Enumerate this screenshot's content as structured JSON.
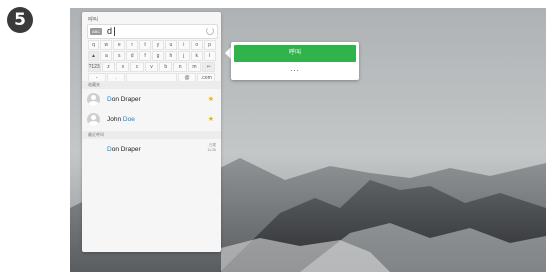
{
  "step": {
    "number": "5"
  },
  "panel": {
    "title": "呼叫",
    "search": {
      "mode": "ABC",
      "value": "d"
    },
    "keyboard": {
      "rows": [
        [
          "q",
          "w",
          "e",
          "r",
          "t",
          "y",
          "u",
          "i",
          "o",
          "p"
        ],
        [
          "▲",
          "a",
          "s",
          "d",
          "f",
          "g",
          "h",
          "j",
          "k",
          "l"
        ],
        [
          "?123",
          "z",
          "x",
          "c",
          "v",
          "b",
          "n",
          "m",
          "⇐"
        ],
        [
          "-",
          ".",
          "",
          "@",
          ".com"
        ]
      ]
    },
    "favorites_label": "收藏夹",
    "favorites": [
      {
        "prefix": "D",
        "rest": "on Draper",
        "starred": "★"
      },
      {
        "prefix": "John ",
        "rest": "Doe",
        "starred": "★"
      }
    ],
    "recent_label": "最近呼叫",
    "recent": [
      {
        "prefix": "D",
        "rest": "on Draper",
        "meta1": "已拨",
        "meta2": "11:26"
      }
    ]
  },
  "callout": {
    "call_label": "呼叫",
    "more_label": "..."
  }
}
